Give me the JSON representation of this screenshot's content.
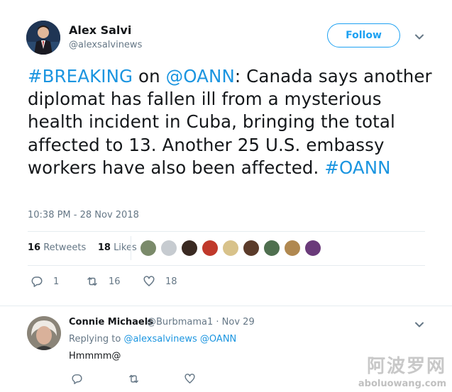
{
  "author": {
    "name": "Alex Salvi",
    "handle": "@alexsalvinews",
    "follow_label": "Follow"
  },
  "tweet": {
    "segments": [
      {
        "text": "#BREAKING",
        "link": true
      },
      {
        "text": " on ",
        "link": false
      },
      {
        "text": "@OANN",
        "link": true
      },
      {
        "text": ": Canada says another diplomat has fallen ill from a mysterious health incident in Cuba, bringing the total affected to 13. Another 25 U.S. embassy workers have also been affected. ",
        "link": false
      },
      {
        "text": "#OANN",
        "link": true
      }
    ],
    "timestamp": "10:38 PM - 28 Nov 2018"
  },
  "stats": {
    "retweets_count": "16",
    "retweets_label": "Retweets",
    "likes_count": "18",
    "likes_label": "Likes"
  },
  "likers": [
    {
      "color": "#7a8a6a"
    },
    {
      "color": "#c6cbd0"
    },
    {
      "color": "#3a2a22"
    },
    {
      "color": "#c0392b"
    },
    {
      "color": "#d8c28a"
    },
    {
      "color": "#5b3b2a"
    },
    {
      "color": "#4f6f4f"
    },
    {
      "color": "#b08850"
    },
    {
      "color": "#6a3a7a"
    }
  ],
  "actions": {
    "replies": "1",
    "retweets": "16",
    "likes": "18"
  },
  "reply": {
    "name": "Connie Michaels",
    "meta": "@Burbmama1 · Nov 29",
    "replying_prefix": "Replying to",
    "replying_to_1": "@alexsalvinews",
    "replying_to_2": "@OANN",
    "text": "Hmmmm@"
  },
  "watermark": {
    "cn": "阿波罗网",
    "url": "aboluowang.com"
  },
  "colors": {
    "link": "#1b95e0",
    "follow": "#1da1f2",
    "muted": "#657786"
  }
}
